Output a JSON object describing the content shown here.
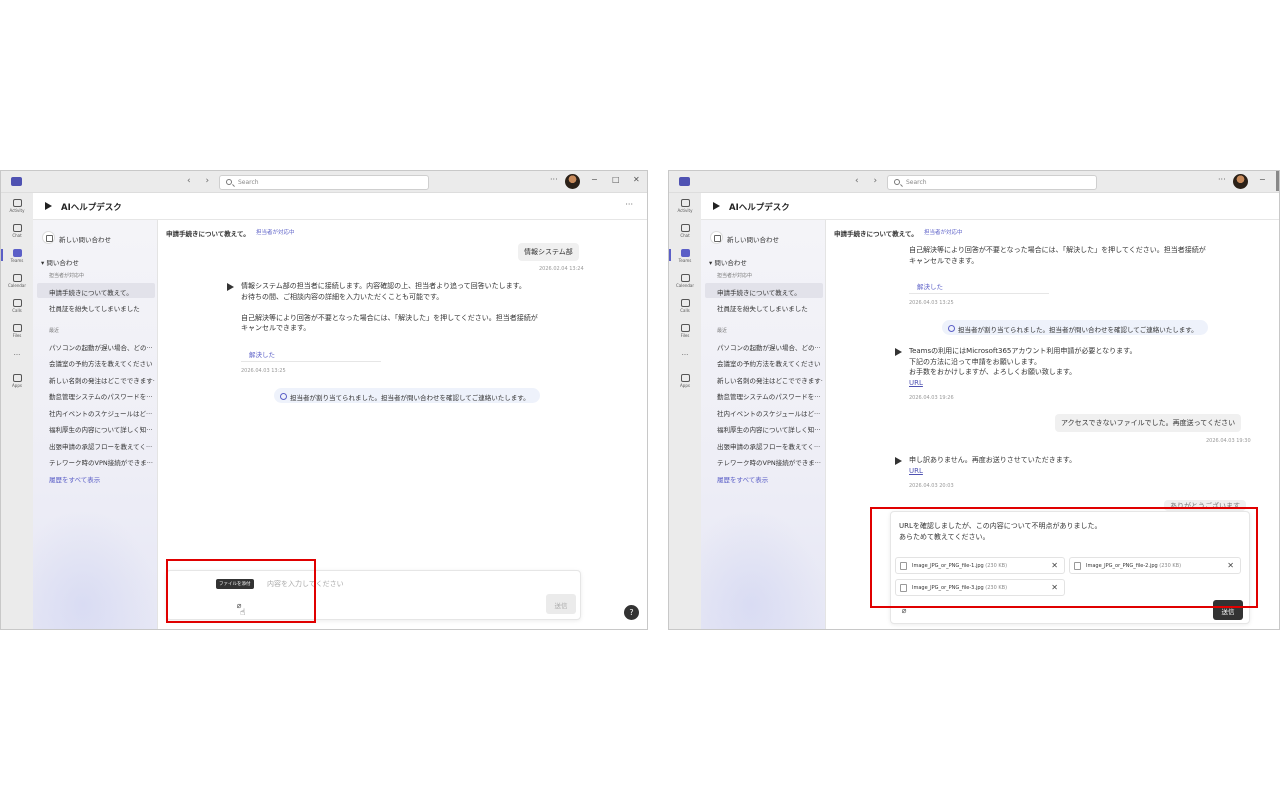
{
  "shared": {
    "search_placeholder": "Search",
    "nav_arrows": "‹ ›",
    "more": "···",
    "rail": [
      "Activity",
      "Chat",
      "Teams",
      "Calendar",
      "Calls",
      "Files",
      "···",
      "Apps"
    ],
    "app_title": "AIヘルプデスク",
    "new_inquiry": "新しい問い合わせ",
    "section_inquiries": "▾ 問い合わせ",
    "sub_assigned": "担当者が対応中",
    "sub_recent": "最近",
    "assigned_items": [
      "申請手続きについて教えて。",
      "社員証を紛失してしまいました"
    ],
    "recent_items": [
      "パソコンの起動が遅い場合、どの···",
      "会議室の予約方法を教えてください",
      "新しい名刺の発注はどこでできます···",
      "勤怠管理システムのパスワードを···",
      "社内イベントのスケジュールはど···",
      "福利厚生の内容について詳しく知···",
      "出張申請の承認フローを教えてく···",
      "テレワーク時のVPN接続ができま···"
    ],
    "history_link": "履歴をすべて表示",
    "thread_title": "申請手続きについて教えて。",
    "thread_badge": "担当者が対応中",
    "resolve": "解決した",
    "notice": "担当者が割り当てられました。担当者が問い合わせを確認してご連絡いたします。",
    "url": "URL"
  },
  "left": {
    "user_msg": "情報システム部",
    "user_ts": "2026.02.04 13:24",
    "bot_lines": [
      "情報システム部の担当者に接続します。内容確認の上、担当者より追って回答いたします。",
      "お待ちの間、ご相談内容の詳細を入力いただくことも可能です。",
      "",
      "自己解決等により回答が不要となった場合には、「解決した」を押してください。担当者接続が",
      "キャンセルできます。"
    ],
    "bot_ts": "2026.04.03 13:25",
    "placeholder": "内容を入力してください",
    "tooltip": "ファイルを添付",
    "send": "送信",
    "help": "?"
  },
  "right": {
    "top_lines": [
      "自己解決等により回答が不要となった場合には、「解決した」を押してください。担当者接続が",
      "キャンセルできます。"
    ],
    "top_ts": "2026.04.03 13:25",
    "bot2_lines": [
      "Teamsの利用にはMicrosoft365アカウント利用申請が必要となります。",
      "下記の方法に沿って申請をお願いします。",
      "お手数をおかけしますが、よろしくお願い致します。"
    ],
    "bot2_ts": "2026.04.03 19:26",
    "user2": "アクセスできないファイルでした。再度送ってください",
    "user2_ts": "2026.04.03 19:30",
    "bot3_line": "申し訳ありません。再度お送りさせていただきます。",
    "bot3_ts": "2026.04.03 20:03",
    "user3_partial": "ありがとうございます",
    "composer_lines": [
      "URLを確認しましたが、この内容について不明点がありました。",
      "あらためて教えてください。"
    ],
    "attachments": [
      {
        "name": "Image_JPG_or_PNG_file-1.jpg",
        "size": "(230 KB)"
      },
      {
        "name": "Image_JPG_or_PNG_file-2.jpg",
        "size": "(230 KB)"
      },
      {
        "name": "Image_JPG_or_PNG_file-3.jpg",
        "size": "(230 KB)"
      }
    ],
    "send": "送信"
  }
}
